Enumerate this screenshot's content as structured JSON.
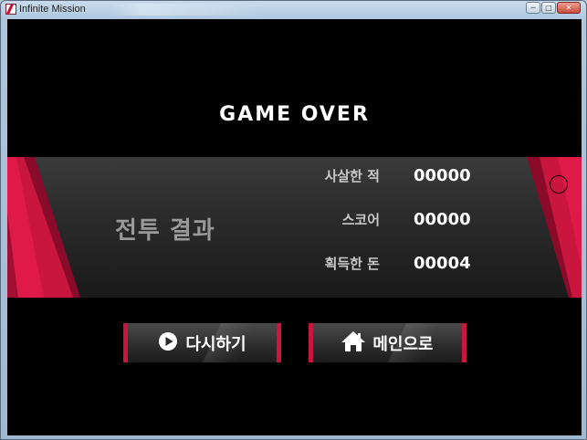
{
  "window": {
    "title": "Infinite Mission",
    "controls": {
      "minimize": "─",
      "maximize": "□",
      "close": "✕"
    }
  },
  "game_over": {
    "title": "GAME OVER",
    "panel_heading": "전투 결과",
    "stats": [
      {
        "label": "사살한 적",
        "value": "00000"
      },
      {
        "label": "스코어",
        "value": "00000"
      },
      {
        "label": "획득한 돈",
        "value": "00004"
      }
    ]
  },
  "buttons": {
    "retry": {
      "label": "다시하기",
      "icon": "play-icon"
    },
    "main_menu": {
      "label": "메인으로",
      "icon": "home-icon"
    }
  },
  "colors": {
    "accent": "#c8163e",
    "background": "#000000",
    "panel": "#2a2a2a"
  }
}
